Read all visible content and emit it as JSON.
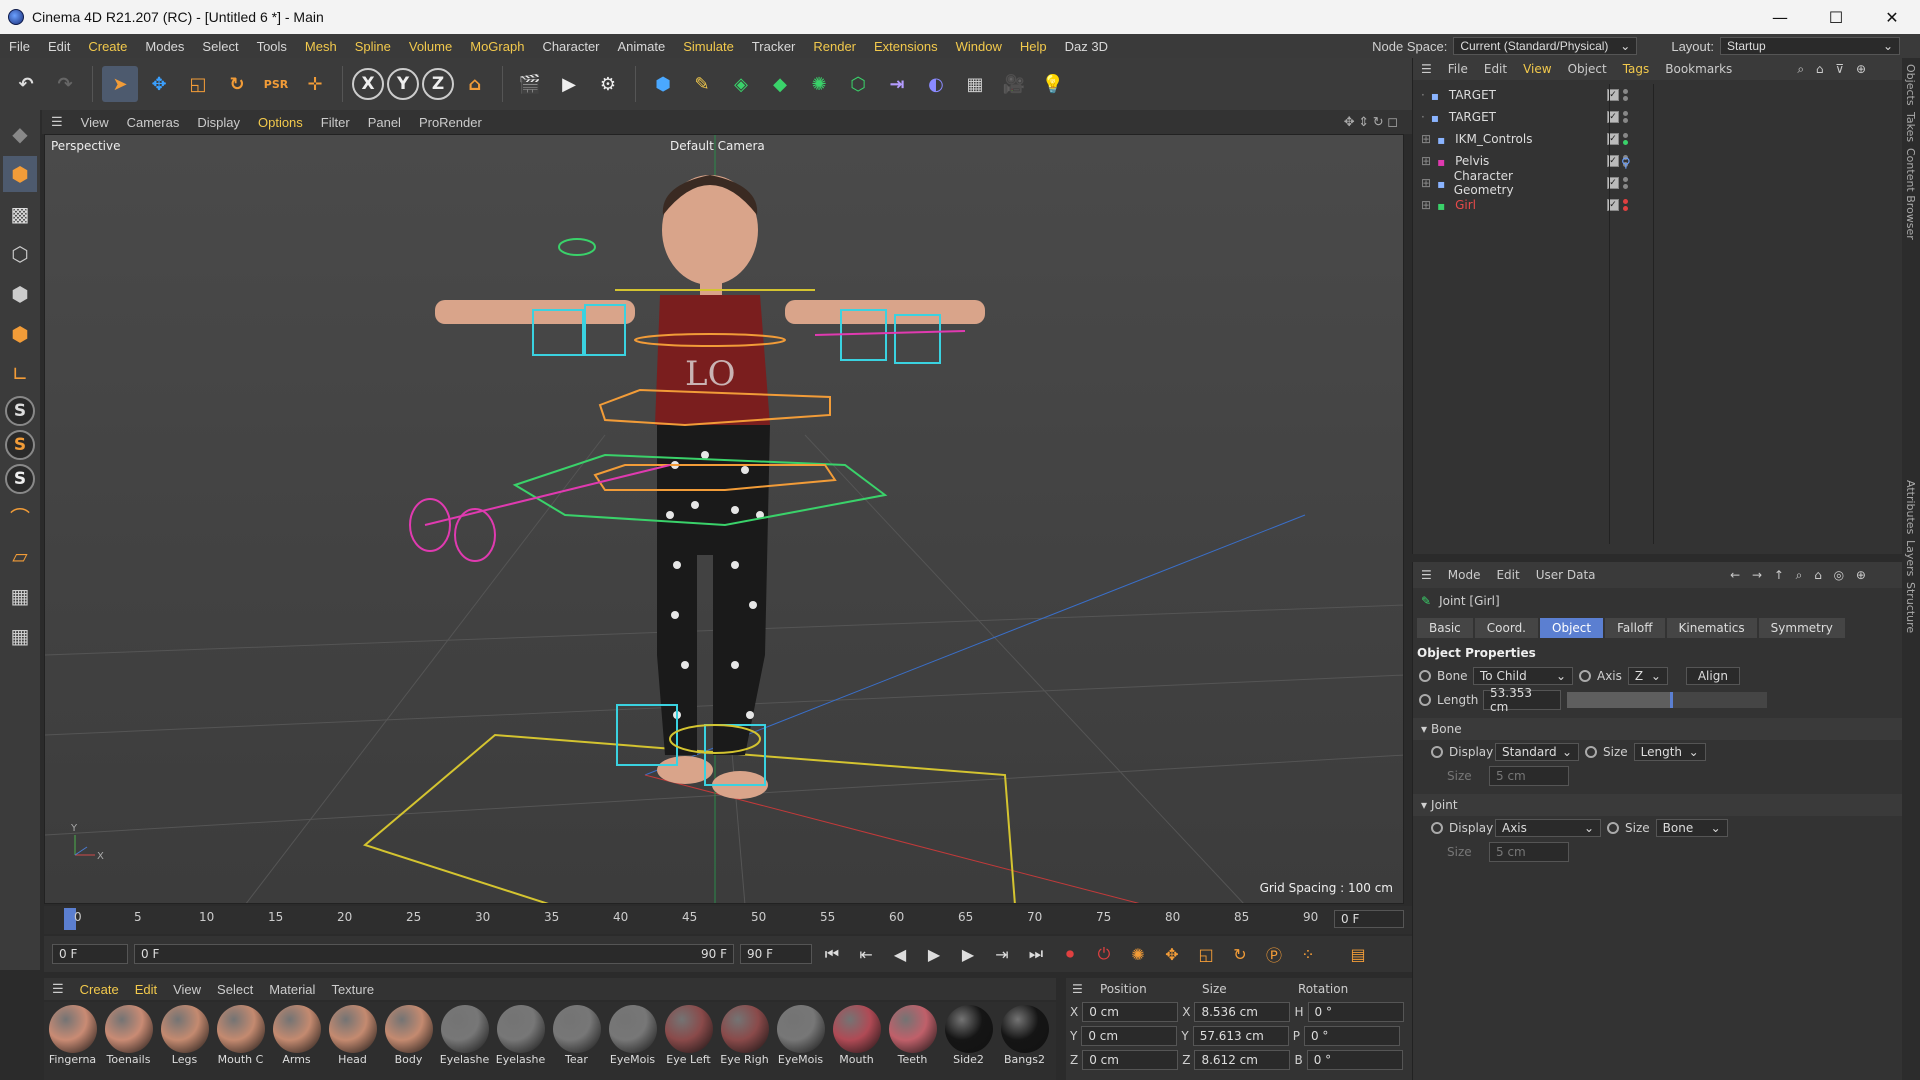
{
  "window": {
    "title": "Cinema 4D R21.207 (RC) - [Untitled 6 *] - Main",
    "buttons": [
      "—",
      "☐",
      "✕"
    ]
  },
  "menu": {
    "items": [
      "File",
      "Edit",
      "Create",
      "Modes",
      "Select",
      "Tools",
      "Mesh",
      "Spline",
      "Volume",
      "MoGraph",
      "Character",
      "Animate",
      "Simulate",
      "Tracker",
      "Render",
      "Extensions",
      "Window",
      "Help",
      "Daz 3D"
    ],
    "node_space_label": "Node Space:",
    "node_space_value": "Current (Standard/Physical)",
    "layout_label": "Layout:",
    "layout_value": "Startup"
  },
  "viewport": {
    "menu": [
      "View",
      "Cameras",
      "Display",
      "Options",
      "Filter",
      "Panel",
      "ProRender"
    ],
    "view_label": "Perspective",
    "camera_label": "Default Camera",
    "grid_spacing": "Grid Spacing : 100 cm"
  },
  "timeline": {
    "ticks": [
      "0",
      "5",
      "10",
      "15",
      "20",
      "25",
      "30",
      "35",
      "40",
      "45",
      "50",
      "55",
      "60",
      "65",
      "70",
      "75",
      "80",
      "85",
      "90"
    ],
    "current_frame": "0 F",
    "start_field": "0 F",
    "range_start": "0 F",
    "range_end": "90 F",
    "end_field": "90 F"
  },
  "materials": {
    "menu": [
      "Create",
      "Edit",
      "View",
      "Select",
      "Material",
      "Texture"
    ],
    "items": [
      {
        "name": "Fingerna",
        "color": "#c98b74"
      },
      {
        "name": "Toenails",
        "color": "#c98b74"
      },
      {
        "name": "Legs",
        "color": "#c48a70"
      },
      {
        "name": "Mouth C",
        "color": "#c48a70"
      },
      {
        "name": "Arms",
        "color": "#c48a70"
      },
      {
        "name": "Head",
        "color": "#c48a70"
      },
      {
        "name": "Body",
        "color": "#c48a70"
      },
      {
        "name": "Eyelashe",
        "color": "#777777"
      },
      {
        "name": "Eyelashe",
        "color": "#777777"
      },
      {
        "name": "Tear",
        "color": "#777777"
      },
      {
        "name": "EyeMois",
        "color": "#777777"
      },
      {
        "name": "Eye Left",
        "color": "#8a4a4a"
      },
      {
        "name": "Eye Righ",
        "color": "#8a4a4a"
      },
      {
        "name": "EyeMois",
        "color": "#777777"
      },
      {
        "name": "Mouth",
        "color": "#b04a55"
      },
      {
        "name": "Teeth",
        "color": "#c0606a"
      },
      {
        "name": "Side2",
        "color": "#151515"
      },
      {
        "name": "Bangs2",
        "color": "#151515"
      }
    ]
  },
  "coords": {
    "headers": [
      "Position",
      "Size",
      "Rotation"
    ],
    "rows": [
      {
        "axis": "X",
        "pos": "0 cm",
        "size_axis": "X",
        "size": "8.536 cm",
        "rot_axis": "H",
        "rot": "0 °"
      },
      {
        "axis": "Y",
        "pos": "0 cm",
        "size_axis": "Y",
        "size": "57.613 cm",
        "rot_axis": "P",
        "rot": "0 °"
      },
      {
        "axis": "Z",
        "pos": "0 cm",
        "size_axis": "Z",
        "size": "8.612 cm",
        "rot_axis": "B",
        "rot": "0 °"
      }
    ]
  },
  "objects": {
    "menu": [
      "File",
      "Edit",
      "View",
      "Object",
      "Tags",
      "Bookmarks"
    ],
    "items": [
      {
        "name": "TARGET",
        "color": "#dddddd"
      },
      {
        "name": "TARGET",
        "color": "#dddddd"
      },
      {
        "name": "IKM_Controls",
        "color": "#dddddd"
      },
      {
        "name": "Pelvis",
        "color": "#dddddd"
      },
      {
        "name": "Character Geometry",
        "color": "#dddddd"
      },
      {
        "name": "Girl",
        "color": "#e84a4a"
      }
    ]
  },
  "attributes": {
    "menu": [
      "Mode",
      "Edit",
      "User Data"
    ],
    "object_title": "Joint [Girl]",
    "tabs": [
      "Basic",
      "Coord.",
      "Object",
      "Falloff",
      "Kinematics",
      "Symmetry"
    ],
    "active_tab": "Object",
    "section": "Object Properties",
    "bone_label": "Bone",
    "bone_value": "To Child",
    "axis_label": "Axis",
    "axis_value": "Z",
    "align_label": "Align",
    "length_label": "Length",
    "length_value": "53.353 cm",
    "bone_group": "Bone",
    "bone_display_label": "Display",
    "bone_display_value": "Standard",
    "bone_size_label": "Size",
    "bone_size_value": "Length",
    "bone_size2_label": "Size",
    "bone_size2_value": "5 cm",
    "joint_group": "Joint",
    "joint_display_label": "Display",
    "joint_display_value": "Axis",
    "joint_size_label": "Size",
    "joint_size_value": "Bone",
    "joint_size2_label": "Size",
    "joint_size2_value": "5 cm"
  },
  "side_tabs": [
    "Objects",
    "Takes",
    "Content Browser",
    "Attributes",
    "Layers",
    "Structure"
  ]
}
